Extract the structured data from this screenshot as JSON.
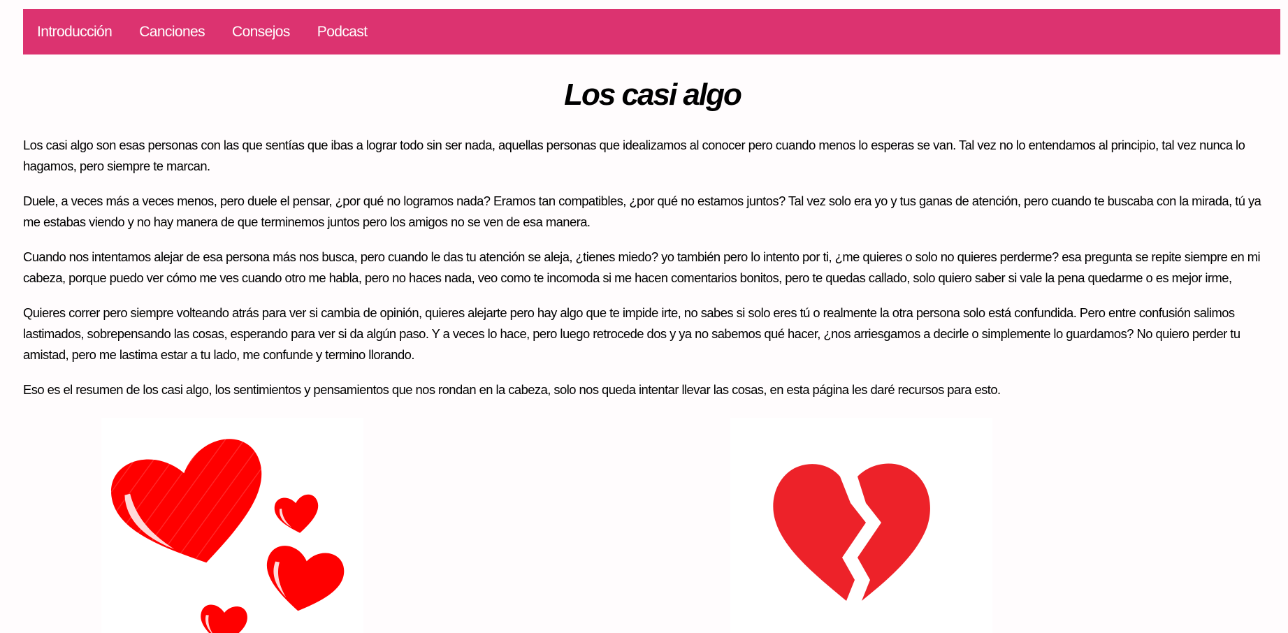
{
  "nav": {
    "items": [
      {
        "label": "Introducción"
      },
      {
        "label": "Canciones"
      },
      {
        "label": "Consejos"
      },
      {
        "label": "Podcast"
      }
    ]
  },
  "page": {
    "title": "Los casi algo"
  },
  "paragraphs": [
    "Los casi algo son esas personas con las que sentías que ibas a lograr todo sin ser nada, aquellas personas que idealizamos al conocer pero cuando menos lo esperas se van. Tal vez no lo entendamos al principio, tal vez nunca lo hagamos, pero siempre te marcan.",
    "Duele, a veces más a veces menos, pero duele el pensar, ¿por qué no logramos nada? Eramos tan compatibles, ¿por qué no estamos juntos? Tal vez solo era yo y tus ganas de atención, pero cuando te buscaba con la mirada, tú ya me estabas viendo y no hay manera de que terminemos juntos pero los amigos no se ven de esa manera.",
    "Cuando nos intentamos alejar de esa persona más nos busca, pero cuando le das tu atención se aleja, ¿tienes miedo? yo también pero lo intento por ti, ¿me quieres o solo no quieres perderme? esa pregunta se repite siempre en mi cabeza, porque puedo ver cómo me ves cuando otro me habla, pero no haces nada, veo como te incomoda si me hacen comentarios bonitos, pero te quedas callado, solo quiero saber si vale la pena quedarme o es mejor irme,",
    "Quieres correr pero siempre volteando atrás para ver si cambia de opinión, quieres alejarte pero hay algo que te impide irte, no sabes si solo eres tú o realmente la otra persona solo está confundida. Pero entre confusión salimos lastimados, sobrepensando las cosas, esperando para ver si da algún paso. Y a veces lo hace, pero luego retrocede dos y ya no sabemos qué hacer, ¿nos arriesgamos a decirle o simplemente lo guardamos? No quiero perder tu amistad, pero me lastima estar a tu lado, me confunde y termino llorando.",
    "Eso es el resumen de los casi algo, los sentimientos y pensamientos que nos rondan en la cabeza, solo nos queda intentar llevar las cosas, en esta página les daré recursos para esto."
  ],
  "images": [
    {
      "icon": "hearts-icon"
    },
    {
      "icon": "broken-heart-icon"
    }
  ],
  "colors": {
    "nav_background": "#dc3370",
    "nav_text": "#ffffff",
    "page_background": "#fffcfd",
    "heart_red": "#ff0000",
    "broken_heart_red": "#ed2229"
  }
}
